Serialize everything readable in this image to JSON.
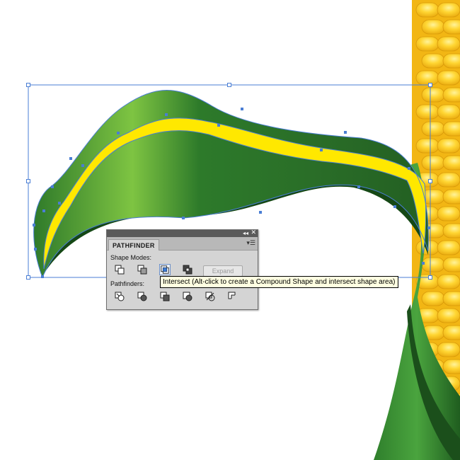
{
  "panel": {
    "title": "PATHFINDER",
    "collapse_icon": "double-chevron-left-icon",
    "close_icon": "close-icon",
    "menu_icon": "panel-menu-icon",
    "shape_modes_label": "Shape Modes:",
    "pathfinders_label": "Pathfinders:",
    "expand_label": "Expand",
    "shape_modes": [
      "unite",
      "minus-front",
      "intersect",
      "exclude"
    ],
    "pathfinders": [
      "divide",
      "trim",
      "merge",
      "crop",
      "outline",
      "minus-back"
    ],
    "active_shape_mode": "intersect"
  },
  "tooltip": {
    "text": "Intersect (Alt-click to create a Compound Shape and intersect shape area)"
  },
  "colors": {
    "leaf_dark": "#1e5a1e",
    "leaf_light": "#7ec442",
    "highlight_yellow": "#ffe800",
    "selection_blue": "#4a7ed4",
    "corn_yellow": "#f7c21a"
  }
}
